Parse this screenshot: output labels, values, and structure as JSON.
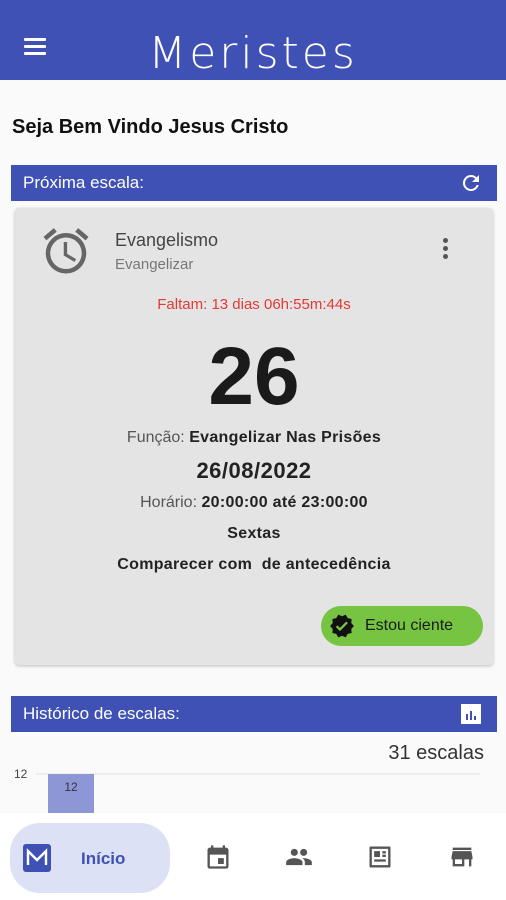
{
  "app": {
    "title": "Meristes",
    "accent": "#3f51b5"
  },
  "welcome": "Seja Bem Vindo Jesus Cristo",
  "next_schedule": {
    "header": "Próxima escala:",
    "event_title": "Evangelismo",
    "event_subtitle": "Evangelizar",
    "countdown": "Faltam: 13 dias 06h:55m:44s",
    "day": "26",
    "function_label": "Função:",
    "function_value": "Evangelizar Nas Prisões",
    "date": "26/08/2022",
    "time_label": "Horário:",
    "time_value": "20:00:00 até 23:00:00",
    "weekday": "Sextas",
    "note": "Comparecer com  de antecedência",
    "confirm_button": "Estou ciente"
  },
  "history": {
    "header": "Histórico de escalas:",
    "count_text": "31 escalas"
  },
  "chart_data": {
    "type": "bar",
    "y_tick_top": "12",
    "categories": [
      ""
    ],
    "values": [
      12
    ],
    "data_labels": [
      "12"
    ]
  },
  "bottom_nav": {
    "active_label": "Início",
    "icons": [
      "home-icon",
      "calendar-icon",
      "people-icon",
      "news-icon",
      "store-icon"
    ]
  }
}
